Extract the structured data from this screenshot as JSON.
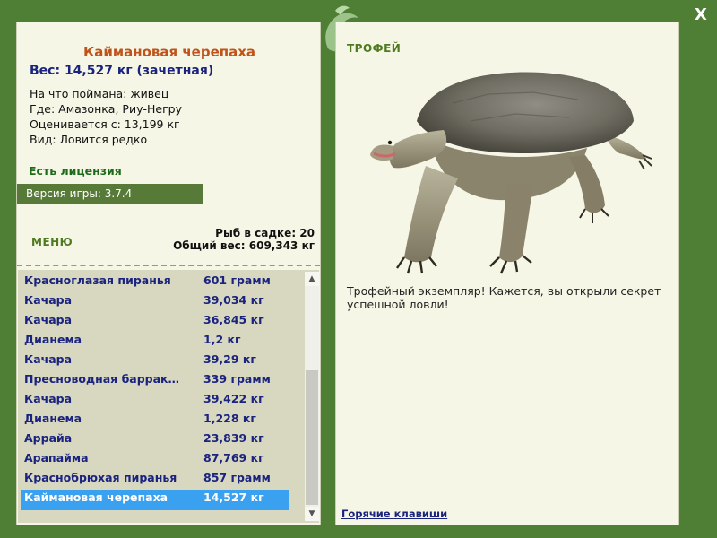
{
  "window": {
    "close_label": "X"
  },
  "fish": {
    "title": "Каймановая черепаха",
    "weight": "Вес: 14,527 кг (зачетная)",
    "caught_on": "На что поймана: живец",
    "location": "Где: Амазонка, Риу-Негру",
    "valued_from": "Оценивается с: 13,199 кг",
    "rarity": "Вид: Ловится редко"
  },
  "license": "Есть лицензия",
  "version": "Версия игры: 3.7.4",
  "menu_label": "МЕНЮ",
  "keep_net": {
    "count_text": "Рыб в садке: 20",
    "total_text": "Общий вес: 609,343 кг"
  },
  "catch_list": [
    {
      "name": "Красноглазая пиранья",
      "weight": "601 грамм"
    },
    {
      "name": "Качара",
      "weight": "39,034 кг"
    },
    {
      "name": "Качара",
      "weight": "36,845 кг"
    },
    {
      "name": "Дианема",
      "weight": "1,2 кг"
    },
    {
      "name": "Качара",
      "weight": "39,29 кг"
    },
    {
      "name": "Пресноводная барраку...",
      "weight": "339 грамм"
    },
    {
      "name": "Качара",
      "weight": "39,422 кг"
    },
    {
      "name": "Дианема",
      "weight": "1,228 кг"
    },
    {
      "name": "Аррайа",
      "weight": "23,839 кг"
    },
    {
      "name": "Арапайма",
      "weight": "87,769 кг"
    },
    {
      "name": "Краснобрюхая пиранья",
      "weight": "857 грамм"
    },
    {
      "name": "Каймановая черепаха",
      "weight": "14,527 кг",
      "selected": true
    }
  ],
  "trophy": {
    "label": "ТРОФЕЙ",
    "description": "Трофейный экземпляр! Кажется, вы открыли секрет успешной ловли!"
  },
  "hotkeys_label": "Горячие клавиши",
  "colors": {
    "frame": "#4f7e35",
    "panel": "#f6f6e6",
    "list_bg": "#d8d8c0",
    "title": "#c0531a",
    "list_text": "#1a237e",
    "selection": "#3aa1f0"
  }
}
